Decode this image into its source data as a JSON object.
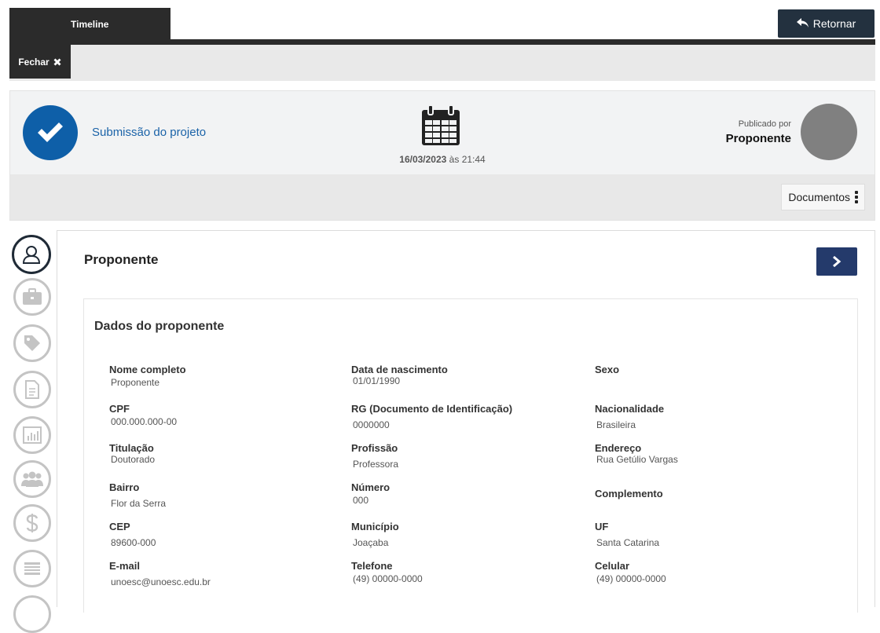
{
  "header": {
    "tab_timeline": "Timeline",
    "retornar_label": "Retornar",
    "fechar_label": "Fechar"
  },
  "event": {
    "title": "Submissão do projeto",
    "date": "16/03/2023",
    "date_sep": "às",
    "time": "21:44",
    "published_by_label": "Publicado por",
    "published_by_name": "Proponente",
    "documents_label": "Documentos"
  },
  "side_icons": [
    "user-icon",
    "briefcase-icon",
    "tag-icon",
    "document-icon",
    "chart-icon",
    "group-icon",
    "dollar-icon",
    "list-icon"
  ],
  "panel": {
    "title": "Proponente",
    "section_title": "Dados do proponente",
    "fields": [
      {
        "label": "Nome completo",
        "value": "Proponente"
      },
      {
        "label": "Data de nascimento",
        "value": "01/01/1990"
      },
      {
        "label": "Sexo",
        "value": ""
      },
      {
        "label": "CPF",
        "value": "000.000.000-00"
      },
      {
        "label": "RG (Documento de Identificação)",
        "value": "0000000"
      },
      {
        "label": "Nacionalidade",
        "value": "Brasileira"
      },
      {
        "label": "Titulação",
        "value": "Doutorado"
      },
      {
        "label": "Profissão",
        "value": "Professora"
      },
      {
        "label": "Endereço",
        "value": "Rua Getúlio Vargas"
      },
      {
        "label": "Bairro",
        "value": "Flor da Serra"
      },
      {
        "label": "Número",
        "value": "000"
      },
      {
        "label": "Complemento",
        "value": ""
      },
      {
        "label": "CEP",
        "value": "89600-000"
      },
      {
        "label": "Município",
        "value": "Joaçaba"
      },
      {
        "label": "UF",
        "value": "Santa Catarina"
      },
      {
        "label": "E-mail",
        "value": "unoesc@unoesc.edu.br"
      },
      {
        "label": "Telefone",
        "value": "(49) 00000-0000"
      },
      {
        "label": "Celular",
        "value": "(49) 00000-0000"
      }
    ]
  },
  "colors": {
    "dark": "#2b2b2b",
    "primary_blue": "#0e5fa8",
    "next_button": "#243a6b",
    "retornar_button": "#23313f"
  }
}
